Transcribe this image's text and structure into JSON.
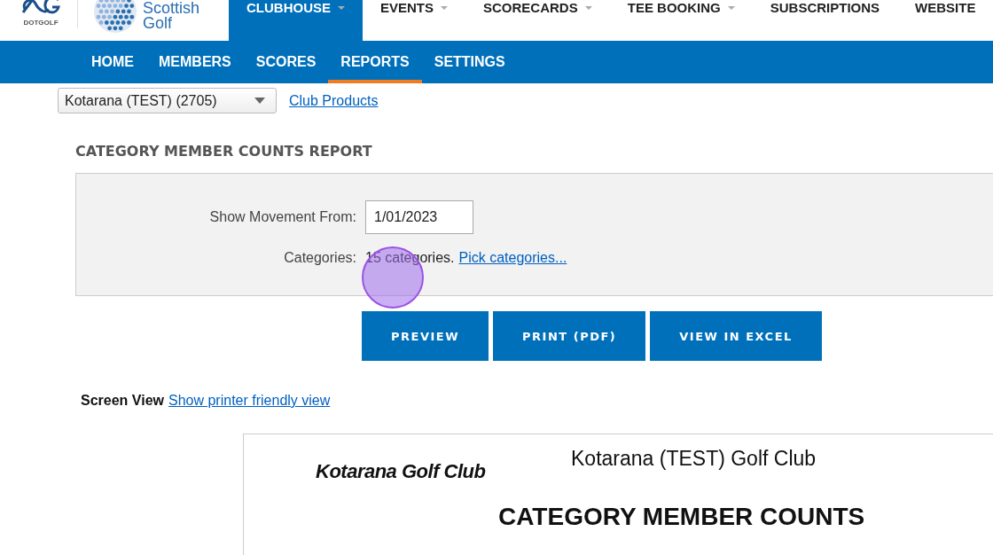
{
  "header": {
    "brand": "DOTGOLF",
    "partner_line_1": "Scottish",
    "partner_line_2": "Golf"
  },
  "main_nav": [
    {
      "label": "CLUBHOUSE",
      "selected": true,
      "has_menu": true
    },
    {
      "label": "EVENTS",
      "selected": false,
      "has_menu": true
    },
    {
      "label": "SCORECARDS",
      "selected": false,
      "has_menu": true
    },
    {
      "label": "TEE BOOKING",
      "selected": false,
      "has_menu": true
    },
    {
      "label": "SUBSCRIPTIONS",
      "selected": false,
      "has_menu": false
    },
    {
      "label": "WEBSITE",
      "selected": false,
      "has_menu": false
    }
  ],
  "sub_nav": [
    {
      "label": "HOME",
      "selected": false
    },
    {
      "label": "MEMBERS",
      "selected": false
    },
    {
      "label": "SCORES",
      "selected": false
    },
    {
      "label": "REPORTS",
      "selected": true
    },
    {
      "label": "SETTINGS",
      "selected": false
    }
  ],
  "club_select": {
    "value": "Kotarana (TEST) (2705)"
  },
  "club_link": "Club Products",
  "report_title": "CATEGORY MEMBER COUNTS REPORT",
  "form": {
    "movement_label": "Show Movement From:",
    "movement_value": "1/01/2023",
    "categories_label": "Categories:",
    "categories_value": "15 categories.",
    "categories_link": "Pick categories..."
  },
  "buttons": [
    "PREVIEW",
    "PRINT (PDF)",
    "VIEW IN EXCEL"
  ],
  "view": {
    "label": "Screen View",
    "link": "Show printer friendly view"
  },
  "preview": {
    "logo_text": "Kotarana Golf Club",
    "club_name": "Kotarana (TEST) Golf Club",
    "heading": "CATEGORY MEMBER COUNTS"
  }
}
